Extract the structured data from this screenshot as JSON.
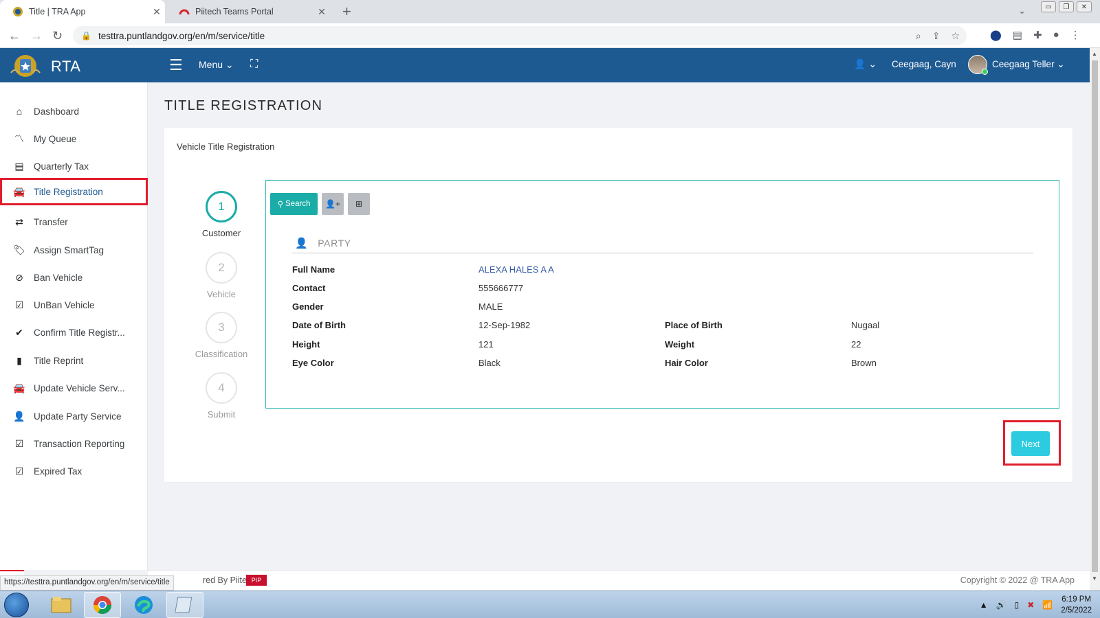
{
  "browser": {
    "tabs": [
      {
        "title": "Title | TRA App",
        "active": true
      },
      {
        "title": "Piitech Teams Portal",
        "active": false
      }
    ],
    "url": "testtra.puntlandgov.org/en/m/service/title",
    "status_url": "https://testtra.puntlandgov.org/en/m/service/title"
  },
  "header": {
    "brand": "RTA",
    "menu_label": "Menu",
    "user_location": "Ceegaag, Cayn",
    "user_role": "Ceegaag Teller",
    "bar_color": "#1e5a92"
  },
  "sidebar": {
    "items": [
      {
        "label": "Dashboard",
        "icon": "home-icon"
      },
      {
        "label": "My Queue",
        "icon": "trend-icon"
      },
      {
        "label": "Quarterly Tax",
        "icon": "list-icon"
      },
      {
        "label": "Title Registration",
        "icon": "car-icon"
      },
      {
        "label": "Transfer",
        "icon": "exchange-icon"
      },
      {
        "label": "Assign SmartTag",
        "icon": "tags-icon"
      },
      {
        "label": "Ban Vehicle",
        "icon": "ban-icon"
      },
      {
        "label": "UnBan Vehicle",
        "icon": "check-square-icon"
      },
      {
        "label": "Confirm Title Registr...",
        "icon": "check-icon"
      },
      {
        "label": "Title Reprint",
        "icon": "file-icon"
      },
      {
        "label": "Update Vehicle Serv...",
        "icon": "car-icon"
      },
      {
        "label": "Update Party Service",
        "icon": "user-icon"
      },
      {
        "label": "Transaction Reporting",
        "icon": "check-square-icon"
      },
      {
        "label": "Expired Tax",
        "icon": "check-square-icon"
      }
    ]
  },
  "page": {
    "title": "TITLE REGISTRATION",
    "subtitle": "Vehicle Title Registration"
  },
  "steps": [
    {
      "num": "1",
      "label": "Customer",
      "active": true
    },
    {
      "num": "2",
      "label": "Vehicle",
      "active": false
    },
    {
      "num": "3",
      "label": "Classification",
      "active": false
    },
    {
      "num": "4",
      "label": "Submit",
      "active": false
    }
  ],
  "toolbar": {
    "search_label": "Search"
  },
  "party": {
    "heading": "PARTY",
    "fields": {
      "full_name": {
        "label": "Full Name",
        "value": "ALEXA HALES A A"
      },
      "contact": {
        "label": "Contact",
        "value": "555666777"
      },
      "gender": {
        "label": "Gender",
        "value": "MALE"
      },
      "dob": {
        "label": "Date of Birth",
        "value": "12-Sep-1982"
      },
      "pob": {
        "label": "Place of Birth",
        "value": "Nugaal"
      },
      "height": {
        "label": "Height",
        "value": "121"
      },
      "weight": {
        "label": "Weight",
        "value": "22"
      },
      "eye": {
        "label": "Eye Color",
        "value": "Black"
      },
      "hair": {
        "label": "Hair Color",
        "value": "Brown"
      }
    }
  },
  "actions": {
    "next_label": "Next"
  },
  "footer": {
    "powered": "red By Piitech",
    "badge": "PIP",
    "copyright": "Copyright © 2022 @ TRA App"
  },
  "taskbar": {
    "time": "6:19 PM",
    "date": "2/5/2022"
  }
}
